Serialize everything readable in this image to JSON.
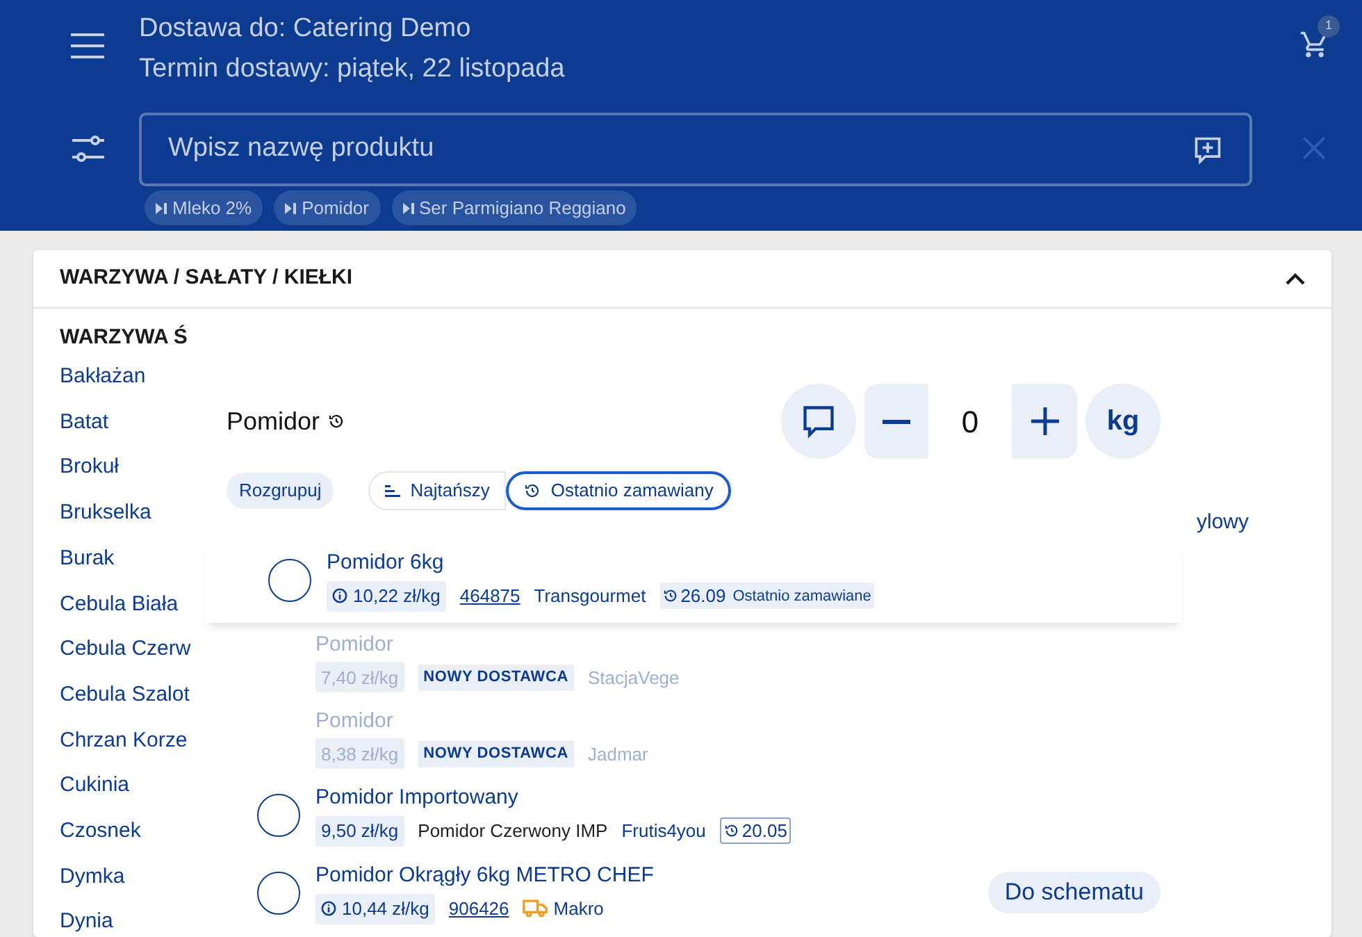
{
  "header": {
    "delivery_to": "Dostawa do: Catering Demo",
    "delivery_date": "Termin dostawy: piątek, 22 listopada",
    "cart_count": "1"
  },
  "search": {
    "placeholder": "Wpisz nazwę produktu"
  },
  "recent_searches": [
    "Mleko 2%",
    "Pomidor",
    "Ser Parmigiano Reggiano"
  ],
  "category": {
    "title": "WARZYWA / SAŁATY / KIEŁKI",
    "expanded": true,
    "subcategory": "WARZYWA Ś",
    "items": [
      "Bakłażan",
      "Batat",
      "Brokuł",
      "Brukselka",
      "Burak",
      "Cebula Biała",
      "Cebula Czerw",
      "Cebula Szalot",
      "Chrzan Korze",
      "Cukinia",
      "Czosnek",
      "Dymka",
      "Dynia"
    ],
    "column_2": "ylowy"
  },
  "modal": {
    "title": "Pomidor",
    "quantity": "0",
    "unit": "kg",
    "ungroup": "Rozgrupuj",
    "sort_options": [
      {
        "kind": "cheapest",
        "label": "Najtańszy",
        "selected": false
      },
      {
        "kind": "recent",
        "label": "Ostatnio zamawiany",
        "selected": true
      }
    ],
    "products": [
      {
        "name": "Pomidor 6kg",
        "muted": false,
        "selected": false,
        "highlighted": true,
        "meta": [
          {
            "kind": "price",
            "text": "10,22 zł/kg",
            "info": true
          },
          {
            "kind": "code",
            "text": "464875"
          },
          {
            "kind": "supplier",
            "text": "Transgourmet"
          },
          {
            "kind": "recent",
            "text": "26.09",
            "label": "Ostatnio zamawiane"
          }
        ]
      },
      {
        "name": "Pomidor",
        "muted": true,
        "highlighted": false,
        "meta": [
          {
            "kind": "price",
            "text": "7,40 zł/kg",
            "info": false
          },
          {
            "kind": "new_supplier",
            "text": "NOWY DOSTAWCA"
          },
          {
            "kind": "supplier",
            "text": "StacjaVege"
          }
        ]
      },
      {
        "name": "Pomidor",
        "muted": true,
        "highlighted": false,
        "meta": [
          {
            "kind": "price",
            "text": "8,38 zł/kg",
            "info": false
          },
          {
            "kind": "new_supplier",
            "text": "NOWY DOSTAWCA"
          },
          {
            "kind": "supplier",
            "text": "Jadmar"
          }
        ]
      },
      {
        "name": "Pomidor Importowany",
        "muted": false,
        "selected": false,
        "highlighted": false,
        "meta": [
          {
            "kind": "price",
            "text": "9,50 zł/kg",
            "info": false
          },
          {
            "kind": "description",
            "text": "Pomidor Czerwony IMP"
          },
          {
            "kind": "supplier",
            "text": "Frutis4you"
          },
          {
            "kind": "recent_outline",
            "text": "20.05"
          }
        ]
      },
      {
        "name": "Pomidor Okrągły 6kg METRO CHEF",
        "muted": false,
        "selected": false,
        "highlighted": false,
        "action": "Do schematu",
        "meta": [
          {
            "kind": "price",
            "text": "10,44 zł/kg",
            "info": true
          },
          {
            "kind": "code",
            "text": "906426"
          },
          {
            "kind": "delivery",
            "text": "Makro"
          }
        ]
      }
    ]
  }
}
